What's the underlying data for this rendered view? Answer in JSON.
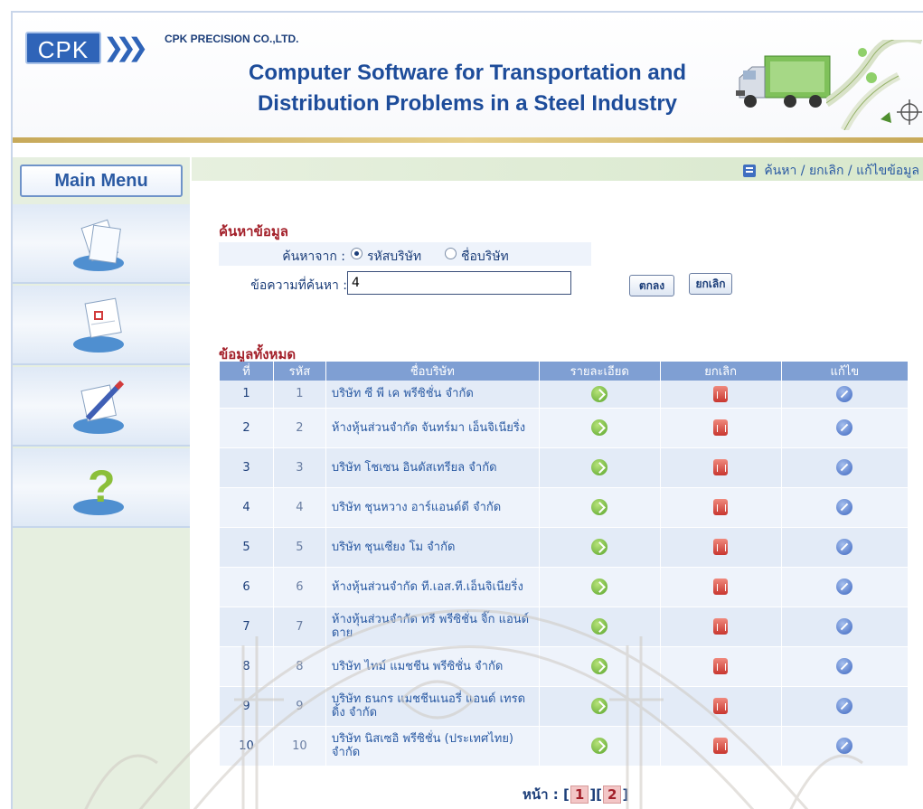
{
  "header": {
    "logo_text": "CPK",
    "logo_arrows": "❯❯❯",
    "company_name": "CPK PRECISION CO.,LTD.",
    "title_line1": "Computer Software for Transportation and",
    "title_line2": "Distribution Problems in a Steel Industry"
  },
  "sidebar": {
    "main_menu_label": "Main Menu",
    "items": [
      {
        "icon": "document-search-icon"
      },
      {
        "icon": "calendar-icon"
      },
      {
        "icon": "pencil-edit-icon"
      },
      {
        "icon": "help-icon"
      }
    ]
  },
  "breadcrumb": "ค้นหา / ยกเลิก / แก้ไขข้อมูล",
  "search": {
    "section_title": "ค้นหาข้อมูล",
    "search_from_label": "ค้นหาจาก :",
    "option_company_code": "รหัสบริษัท",
    "option_company_name": "ชื่อบริษัท",
    "selected_option": "รหัสบริษัท",
    "query_label": "ข้อความที่ค้นหา :",
    "query_value": "4",
    "ok_button": "ตกลง",
    "cancel_button": "ยกเลิก"
  },
  "table": {
    "section_title": "ข้อมูลทั้งหมด",
    "headers": [
      "ที่",
      "รหัส",
      "ชื่อบริษัท",
      "รายละเอียด",
      "ยกเลิก",
      "แก้ไข"
    ],
    "rows": [
      {
        "no": "1",
        "code": "1",
        "name": "บริษัท ซี พี เค พรีซิชั่น จำกัด"
      },
      {
        "no": "2",
        "code": "2",
        "name": "ห้างหุ้นส่วนจำกัด จันทร์มา เอ็นจิเนียริ่ง"
      },
      {
        "no": "3",
        "code": "3",
        "name": "บริษัท โชเซน อินดัสเทรียล จำกัด"
      },
      {
        "no": "4",
        "code": "4",
        "name": "บริษัท ชุนหวาง อาร์แอนด์ดี จำกัด"
      },
      {
        "no": "5",
        "code": "5",
        "name": "บริษัท ชุนเซียง โม จำกัด"
      },
      {
        "no": "6",
        "code": "6",
        "name": "ห้างหุ้นส่วนจำกัด ที.เอส.ที.เอ็นจิเนียริ่ง"
      },
      {
        "no": "7",
        "code": "7",
        "name": "ห้างหุ้นส่วนจำกัด ทรี พรีซิชั่น จิ๊ก แอนด์ ดาย"
      },
      {
        "no": "8",
        "code": "8",
        "name": "บริษัท ไทม์ แมชชีน พรีซิชั่น จำกัด"
      },
      {
        "no": "9",
        "code": "9",
        "name": "บริษัท ธนกร แมชชีนเนอรี่ แอนด์ เทรดดิ้ง จำกัด"
      },
      {
        "no": "10",
        "code": "10",
        "name": "บริษัท นิสเซอิ พรีซิชั่น (ประเทศไทย) จำกัด"
      }
    ]
  },
  "pager": {
    "label": "หน้า :",
    "pages": [
      "1",
      "2"
    ]
  },
  "colors": {
    "accent_blue": "#2f64b8",
    "section_title_red": "#a3202a",
    "table_header": "#7f9fd3",
    "sidebar_green": "#e6efe0"
  }
}
